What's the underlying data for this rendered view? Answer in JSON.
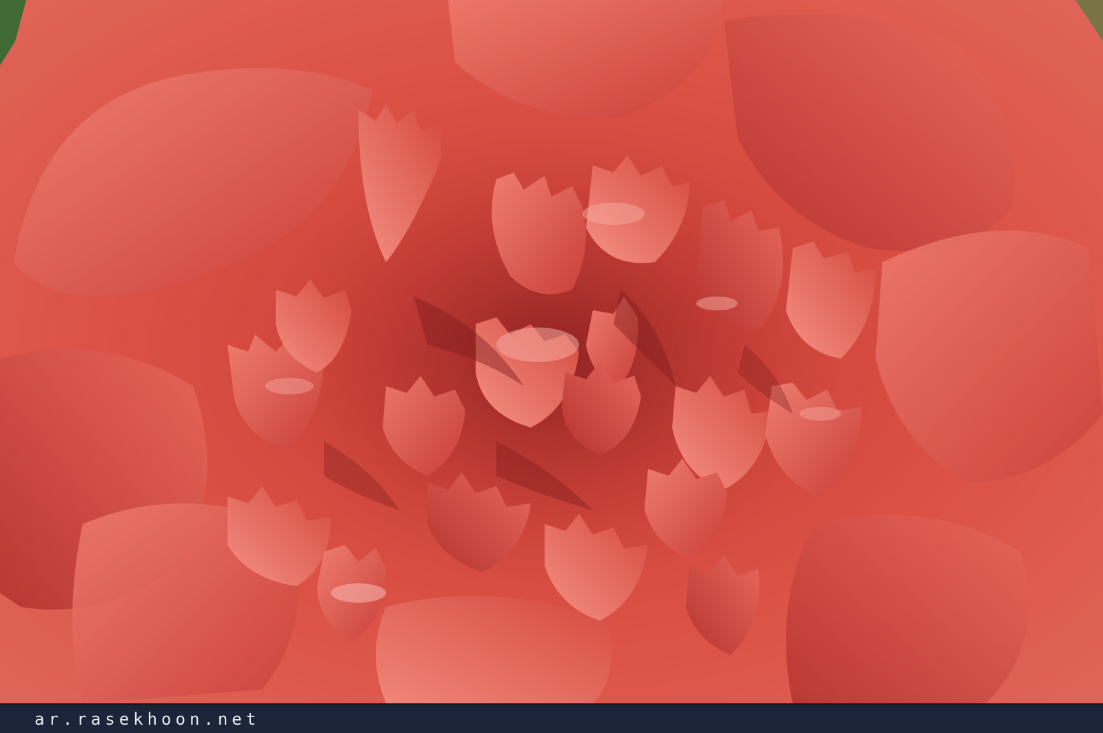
{
  "photo": {
    "subject_icon": "carnation-flower-photo",
    "colors": {
      "petal_base": "#d84a3f",
      "petal_light": "#ef7a6e",
      "petal_highlight": "#f6a9a0",
      "petal_shadow": "#a82d28",
      "petal_deep": "#7e1c1c",
      "corner_green": "#3f6a34"
    }
  },
  "footer": {
    "watermark": "ar.rasekhoon.net",
    "background": "#1b2438",
    "text_color": "#e9ecf2"
  }
}
